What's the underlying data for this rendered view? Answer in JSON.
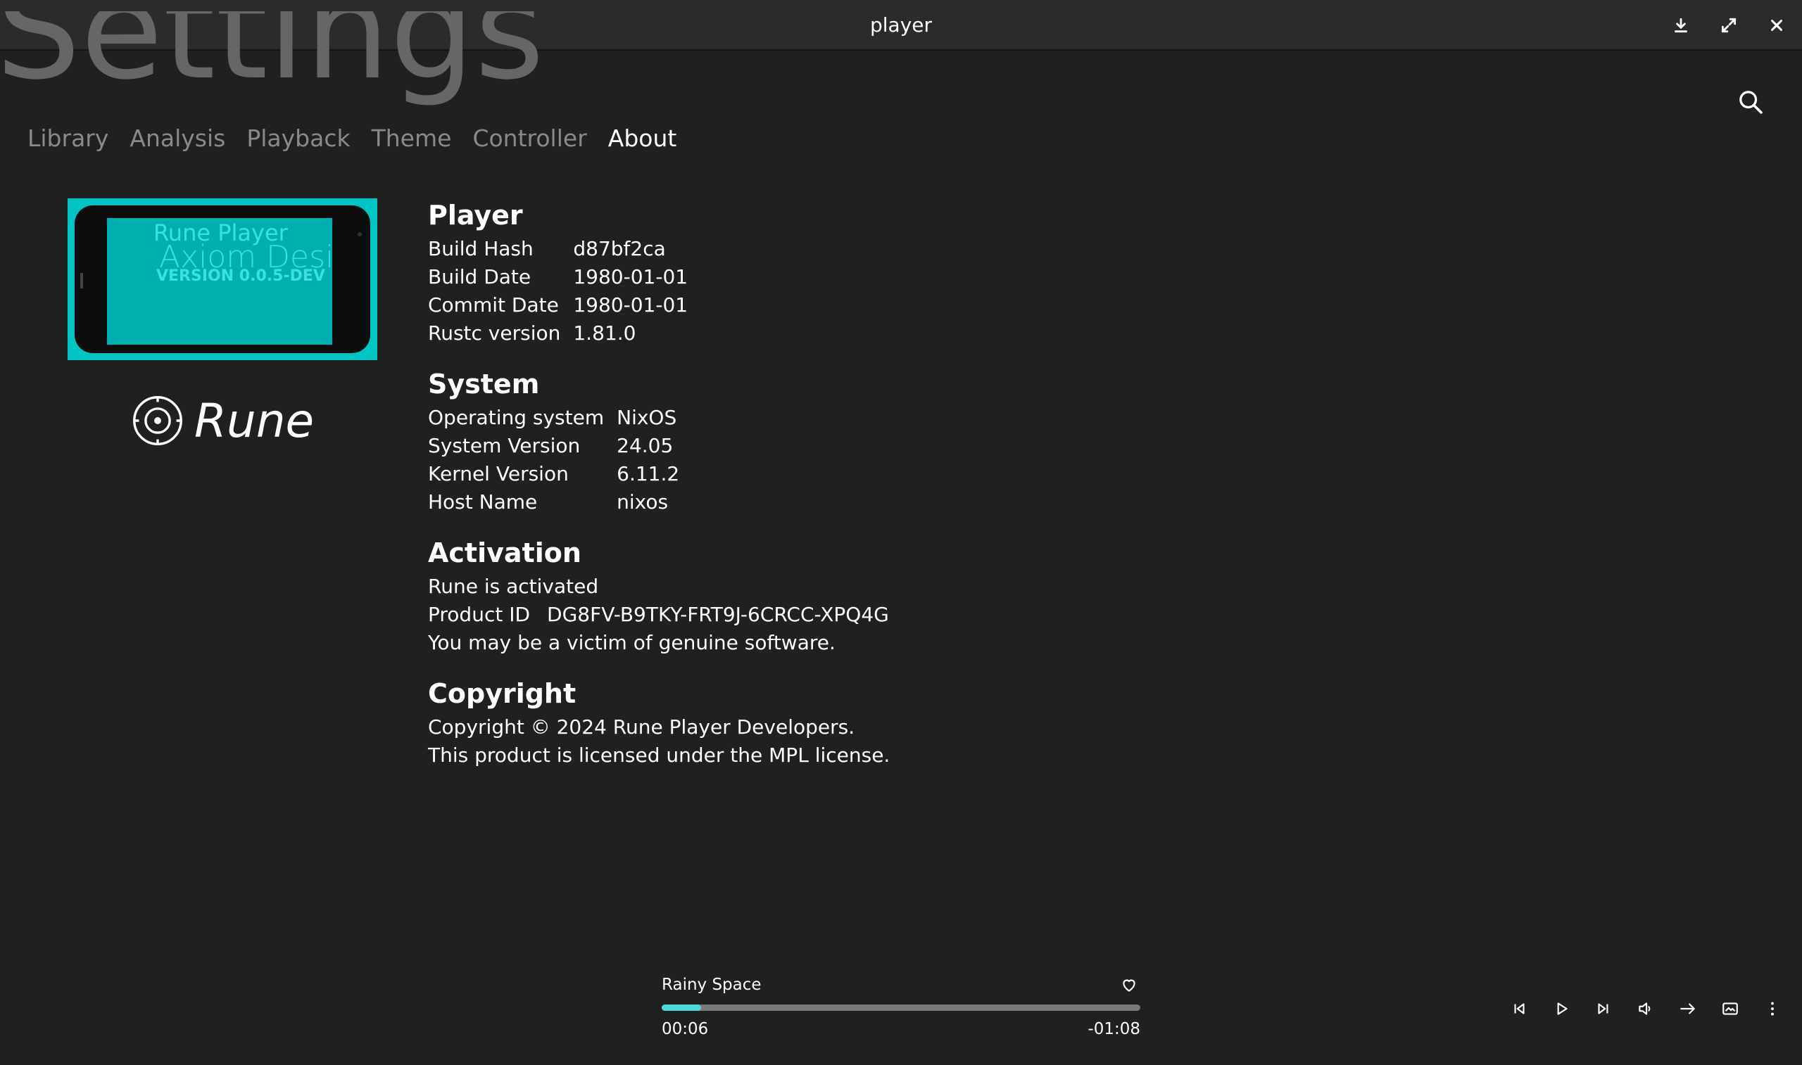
{
  "window": {
    "title": "player"
  },
  "page": {
    "heading": "Settings",
    "tabs": [
      {
        "label": "Library"
      },
      {
        "label": "Analysis"
      },
      {
        "label": "Playback"
      },
      {
        "label": "Theme"
      },
      {
        "label": "Controller"
      },
      {
        "label": "About",
        "active": true
      }
    ]
  },
  "splash": {
    "line1": "Rune Player",
    "line2": "Axiom Design",
    "line3": "VERSION 0.0.5-DEV"
  },
  "brand": {
    "name": "Rune"
  },
  "about": {
    "player": {
      "title": "Player",
      "rows": [
        {
          "key": "Build Hash",
          "value": "d87bf2ca"
        },
        {
          "key": "Build Date",
          "value": "1980-01-01"
        },
        {
          "key": "Commit Date",
          "value": "1980-01-01"
        },
        {
          "key": "Rustc version",
          "value": "1.81.0"
        }
      ]
    },
    "system": {
      "title": "System",
      "rows": [
        {
          "key": "Operating system",
          "value": "NixOS"
        },
        {
          "key": "System Version",
          "value": "24.05"
        },
        {
          "key": "Kernel Version",
          "value": "6.11.2"
        },
        {
          "key": "Host Name",
          "value": "nixos"
        }
      ]
    },
    "activation": {
      "title": "Activation",
      "status": "Rune is activated",
      "product_id_label": "Product ID",
      "product_id": "DG8FV-B9TKY-FRT9J-6CRCC-XPQ4G",
      "note": "You may be a victim of genuine software."
    },
    "copyright": {
      "title": "Copyright",
      "line1": "Copyright © 2024 Rune Player Developers.",
      "line2": "This product is licensed under the MPL license."
    }
  },
  "player": {
    "track_title": "Rainy Space",
    "elapsed": "00:06",
    "remaining": "-01:08",
    "progress": 0.082
  },
  "colors": {
    "accent": "#4fd8d8",
    "splash": "#00c4c4",
    "background": "#202020"
  },
  "icons": {
    "window": [
      "download-icon",
      "maximize-icon",
      "close-icon"
    ],
    "controls": [
      "skip-previous-icon",
      "play-icon",
      "skip-next-icon",
      "volume-icon",
      "playback-mode-icon",
      "cover-wall-icon",
      "more-icon"
    ]
  }
}
